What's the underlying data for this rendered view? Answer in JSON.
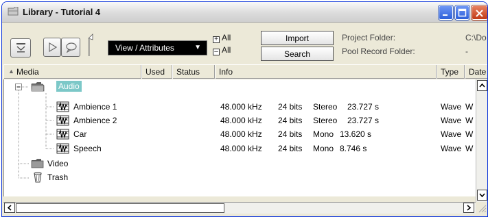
{
  "window": {
    "title": "Library - Tutorial 4"
  },
  "toolbar": {
    "view_dropdown": "View / Attributes",
    "all_expand": "All",
    "all_collapse": "All",
    "import_label": "Import",
    "search_label": "Search",
    "project_folder_label": "Project Folder:",
    "project_folder_value": "C:\\Do",
    "pool_record_label": "Pool Record Folder:",
    "pool_record_value": "-"
  },
  "columns": [
    "Media",
    "Used",
    "Status",
    "Info",
    "Type",
    "Date"
  ],
  "tree": {
    "audio": "Audio",
    "video": "Video",
    "trash": "Trash",
    "clips": [
      {
        "name": "Ambience 1",
        "rate": "48.000 kHz",
        "bits": "24 bits",
        "channels": "Stereo",
        "length": "23.727 s",
        "type": "Wave",
        "date": "W"
      },
      {
        "name": "Ambience 2",
        "rate": "48.000 kHz",
        "bits": "24 bits",
        "channels": "Stereo",
        "length": "23.727 s",
        "type": "Wave",
        "date": "W"
      },
      {
        "name": "Car",
        "rate": "48.000 kHz",
        "bits": "24 bits",
        "channels": "Mono",
        "length": "13.620 s",
        "type": "Wave",
        "date": "W"
      },
      {
        "name": "Speech",
        "rate": "48.000 kHz",
        "bits": "24 bits",
        "channels": "Mono",
        "length": "8.746 s",
        "type": "Wave",
        "date": "W"
      }
    ]
  },
  "colors": {
    "selection": "#7cc8c8",
    "title_close": "#c03a16",
    "title_buttons": "#2c5fd9"
  },
  "icons": [
    "library-icon",
    "minimize-icon",
    "maximize-icon",
    "close-icon",
    "import-icon",
    "play-icon",
    "loop-icon",
    "folder-icon",
    "wave-icon",
    "trash-icon"
  ]
}
